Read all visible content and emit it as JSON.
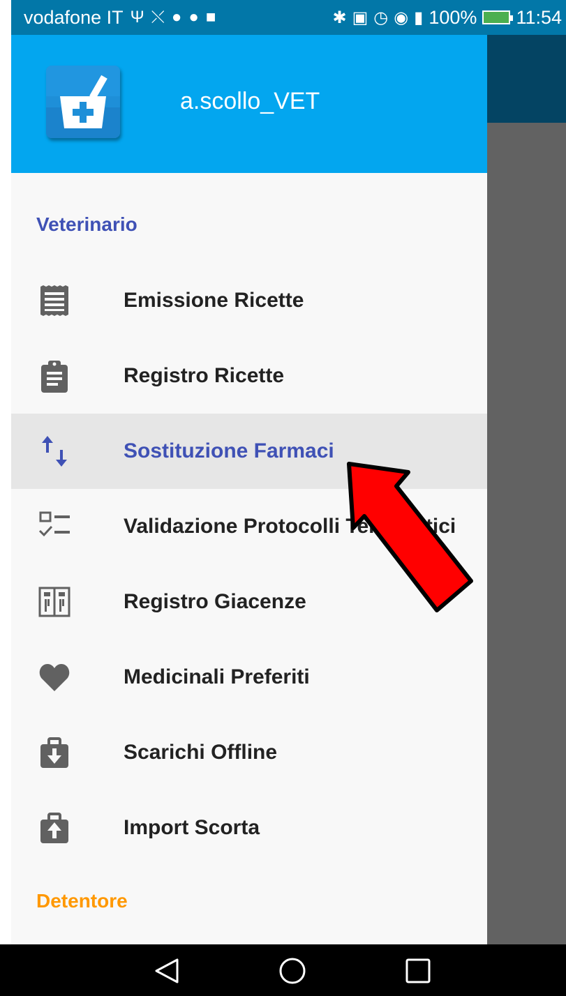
{
  "status_bar": {
    "carrier": "vodafone IT",
    "battery": "100%",
    "time": "11:54",
    "left_icons": [
      "usb-icon",
      "missed-call-icon",
      "app-icon",
      "chat-icon",
      "facebook-icon"
    ],
    "right_icons": [
      "bluetooth-icon",
      "nfc-icon",
      "alarm-icon",
      "eye-icon",
      "signal-icon",
      "battery-icon"
    ]
  },
  "drawer": {
    "username": "a.scollo_VET",
    "sections": [
      {
        "title": "Veterinario",
        "color": "#3f51b5",
        "items": [
          {
            "label": "Emissione Ricette",
            "icon": "receipt-icon"
          },
          {
            "label": "Registro Ricette",
            "icon": "clipboard-icon"
          },
          {
            "label": "Sostituzione Farmaci",
            "icon": "swap-vertical-icon",
            "active": true
          },
          {
            "label": "Validazione Protocolli Terapeutici",
            "icon": "checklist-icon"
          },
          {
            "label": "Registro Giacenze",
            "icon": "inventory-icon"
          },
          {
            "label": "Medicinali Preferiti",
            "icon": "heart-icon"
          },
          {
            "label": "Scarichi Offline",
            "icon": "briefcase-download-icon"
          },
          {
            "label": "Import Scorta",
            "icon": "briefcase-upload-icon"
          }
        ]
      },
      {
        "title": "Detentore",
        "color": "#ff9800"
      }
    ]
  },
  "nav_bar": {
    "buttons": [
      "back-icon",
      "home-icon",
      "recents-icon"
    ]
  },
  "colors": {
    "header": "#03a6ef",
    "status_bar": "#0277a8",
    "accent": "#3f51b5",
    "section_secondary": "#ff9800",
    "annotation_arrow": "#ff0000"
  }
}
